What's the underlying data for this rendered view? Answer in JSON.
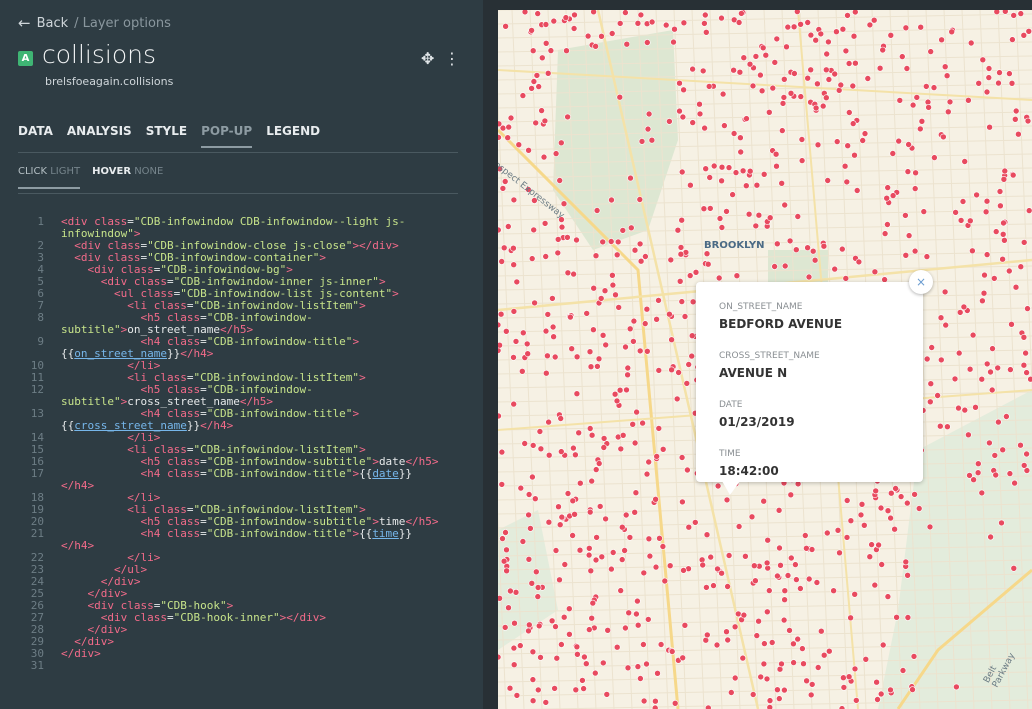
{
  "header": {
    "back_label": "Back",
    "breadcrumb": "/ Layer options",
    "layer_badge": "A",
    "layer_title": "collisions",
    "layer_source": "brelsfoeagain.collisions",
    "tool_icons": [
      "move-icon",
      "more-vertical-icon"
    ]
  },
  "tabs": [
    {
      "label": "DATA"
    },
    {
      "label": "ANALYSIS"
    },
    {
      "label": "STYLE"
    },
    {
      "label": "POP-UP",
      "active": true
    },
    {
      "label": "LEGEND"
    }
  ],
  "subtabs": [
    {
      "key": "CLICK",
      "value": "LIGHT",
      "active": true
    },
    {
      "key": "HOVER",
      "value": "NONE"
    }
  ],
  "map": {
    "labels": {
      "brooklyn": "BROOKLYN",
      "expressway": "ospect Expressway",
      "belt": "Belt Parkway"
    },
    "dot_color": "#e84a5f",
    "popup": {
      "fields": [
        {
          "subtitle": "ON_STREET_NAME",
          "title": "BEDFORD AVENUE"
        },
        {
          "subtitle": "CROSS_STREET_NAME",
          "title": "AVENUE N"
        },
        {
          "subtitle": "DATE",
          "title": "01/23/2019"
        },
        {
          "subtitle": "TIME",
          "title": "18:42:00"
        }
      ],
      "close_label": "×"
    }
  },
  "code_lines": [
    {
      "n": "1",
      "html": "<span class='tag'>&lt;div</span> <span class='attr'>class</span>=<span class='str'>\"CDB-infowindow CDB-infowindow--light js-infowindow\"</span><span class='tag'>&gt;</span>"
    },
    {
      "n": "2",
      "html": "  <span class='tag'>&lt;div</span> <span class='attr'>class</span>=<span class='str'>\"CDB-infowindow-close js-close\"</span><span class='tag'>&gt;&lt;/div&gt;</span>"
    },
    {
      "n": "3",
      "html": "  <span class='tag'>&lt;div</span> <span class='attr'>class</span>=<span class='str'>\"CDB-infowindow-container\"</span><span class='tag'>&gt;</span>"
    },
    {
      "n": "4",
      "html": "    <span class='tag'>&lt;div</span> <span class='attr'>class</span>=<span class='str'>\"CDB-infowindow-bg\"</span><span class='tag'>&gt;</span>"
    },
    {
      "n": "5",
      "html": "      <span class='tag'>&lt;div</span> <span class='attr'>class</span>=<span class='str'>\"CDB-infowindow-inner js-inner\"</span><span class='tag'>&gt;</span>"
    },
    {
      "n": "6",
      "html": "        <span class='tag'>&lt;ul</span> <span class='attr'>class</span>=<span class='str'>\"CDB-infowindow-list js-content\"</span><span class='tag'>&gt;</span>"
    },
    {
      "n": "7",
      "html": "          <span class='tag'>&lt;li</span> <span class='attr'>class</span>=<span class='str'>\"CDB-infowindow-listItem\"</span><span class='tag'>&gt;</span>"
    },
    {
      "n": "8",
      "html": "            <span class='tag'>&lt;h5</span> <span class='attr'>class</span>=<span class='str'>\"CDB-infowindow-subtitle\"</span><span class='tag'>&gt;</span>on_street_name<span class='tag'>&lt;/h5&gt;</span>"
    },
    {
      "n": "9",
      "html": "            <span class='tag'>&lt;h4</span> <span class='attr'>class</span>=<span class='str'>\"CDB-infowindow-title\"</span><span class='tag'>&gt;</span>{{<span class='var'>on_street_name</span>}}<span class='tag'>&lt;/h4&gt;</span>"
    },
    {
      "n": "10",
      "html": "          <span class='tag'>&lt;/li&gt;</span>"
    },
    {
      "n": "11",
      "html": "          <span class='tag'>&lt;li</span> <span class='attr'>class</span>=<span class='str'>\"CDB-infowindow-listItem\"</span><span class='tag'>&gt;</span>"
    },
    {
      "n": "12",
      "html": "            <span class='tag'>&lt;h5</span> <span class='attr'>class</span>=<span class='str'>\"CDB-infowindow-subtitle\"</span><span class='tag'>&gt;</span>cross_street_name<span class='tag'>&lt;/h5&gt;</span>"
    },
    {
      "n": "13",
      "html": "            <span class='tag'>&lt;h4</span> <span class='attr'>class</span>=<span class='str'>\"CDB-infowindow-title\"</span><span class='tag'>&gt;</span>{{<span class='var'>cross_street_name</span>}}<span class='tag'>&lt;/h4&gt;</span>"
    },
    {
      "n": "14",
      "html": "          <span class='tag'>&lt;/li&gt;</span>"
    },
    {
      "n": "15",
      "html": "          <span class='tag'>&lt;li</span> <span class='attr'>class</span>=<span class='str'>\"CDB-infowindow-listItem\"</span><span class='tag'>&gt;</span>"
    },
    {
      "n": "16",
      "html": "            <span class='tag'>&lt;h5</span> <span class='attr'>class</span>=<span class='str'>\"CDB-infowindow-subtitle\"</span><span class='tag'>&gt;</span>date<span class='tag'>&lt;/h5&gt;</span>"
    },
    {
      "n": "17",
      "html": "            <span class='tag'>&lt;h4</span> <span class='attr'>class</span>=<span class='str'>\"CDB-infowindow-title\"</span><span class='tag'>&gt;</span>{{<span class='var'>date</span>}}<span class='tag'>&lt;/h4&gt;</span>"
    },
    {
      "n": "18",
      "html": "          <span class='tag'>&lt;/li&gt;</span>"
    },
    {
      "n": "19",
      "html": "          <span class='tag'>&lt;li</span> <span class='attr'>class</span>=<span class='str'>\"CDB-infowindow-listItem\"</span><span class='tag'>&gt;</span>"
    },
    {
      "n": "20",
      "html": "            <span class='tag'>&lt;h5</span> <span class='attr'>class</span>=<span class='str'>\"CDB-infowindow-subtitle\"</span><span class='tag'>&gt;</span>time<span class='tag'>&lt;/h5&gt;</span>"
    },
    {
      "n": "21",
      "html": "            <span class='tag'>&lt;h4</span> <span class='attr'>class</span>=<span class='str'>\"CDB-infowindow-title\"</span><span class='tag'>&gt;</span>{{<span class='var'>time</span>}}<span class='tag'>&lt;/h4&gt;</span>"
    },
    {
      "n": "22",
      "html": "          <span class='tag'>&lt;/li&gt;</span>"
    },
    {
      "n": "23",
      "html": "        <span class='tag'>&lt;/ul&gt;</span>"
    },
    {
      "n": "24",
      "html": "      <span class='tag'>&lt;/div&gt;</span>"
    },
    {
      "n": "25",
      "html": "    <span class='tag'>&lt;/div&gt;</span>"
    },
    {
      "n": "26",
      "html": "    <span class='tag'>&lt;div</span> <span class='attr'>class</span>=<span class='str'>\"CDB-hook\"</span><span class='tag'>&gt;</span>"
    },
    {
      "n": "27",
      "html": "      <span class='tag'>&lt;div</span> <span class='attr'>class</span>=<span class='str'>\"CDB-hook-inner\"</span><span class='tag'>&gt;&lt;/div&gt;</span>"
    },
    {
      "n": "28",
      "html": "    <span class='tag'>&lt;/div&gt;</span>"
    },
    {
      "n": "29",
      "html": "  <span class='tag'>&lt;/div&gt;</span>"
    },
    {
      "n": "30",
      "html": "<span class='tag'>&lt;/div&gt;</span>"
    },
    {
      "n": "31",
      "html": ""
    }
  ]
}
